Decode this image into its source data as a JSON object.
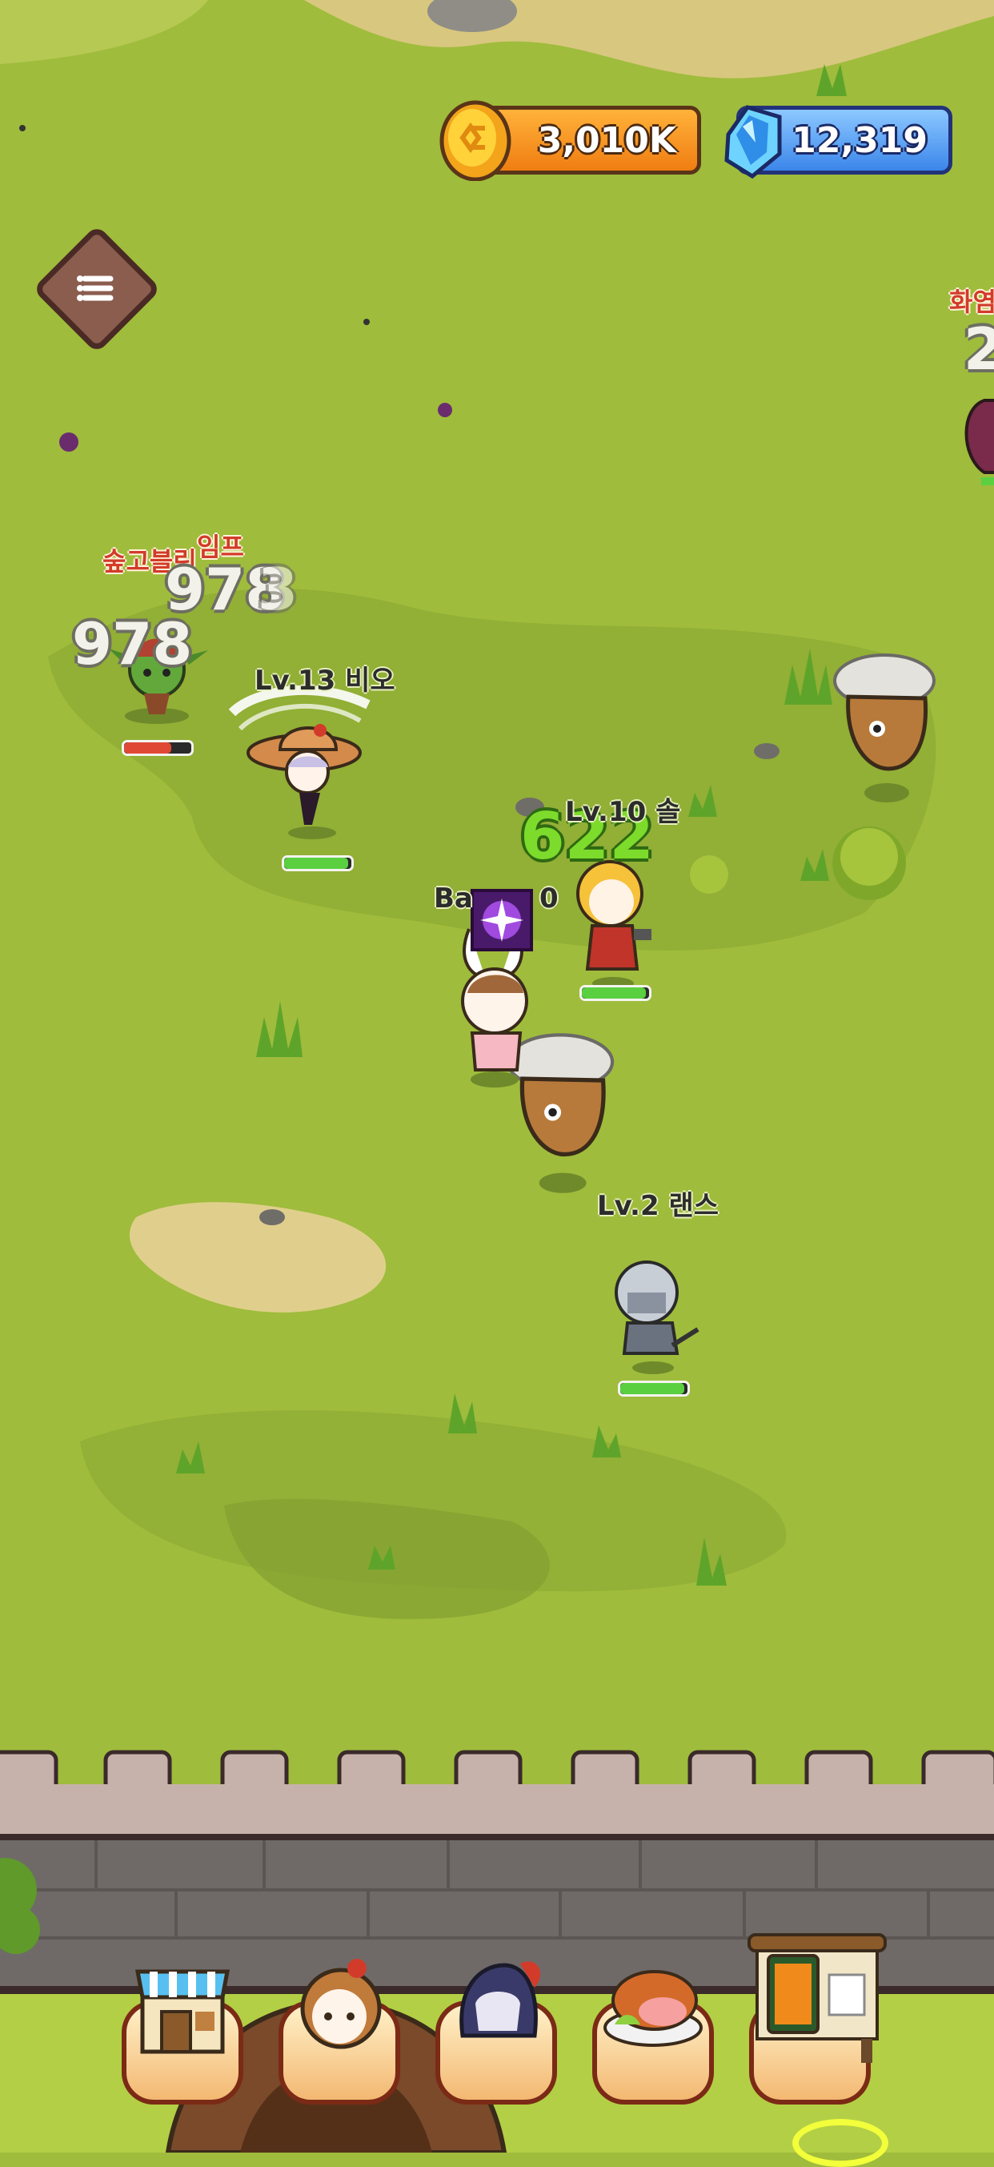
{
  "hud": {
    "gold": "3,010K",
    "gems": "12,319"
  },
  "heroes": [
    {
      "label": "Lv.13 비오"
    },
    {
      "label": "Lv.10 솔"
    },
    {
      "label": "Lv.2 랜스"
    },
    {
      "label": "Ba"
    },
    {
      "label": "0"
    }
  ],
  "enemies": [
    {
      "name": "숲고블린"
    },
    {
      "name": "임프"
    },
    {
      "name": "화염"
    }
  ],
  "damage_numbers": {
    "d1": "978",
    "d2": "978",
    "d3": "3",
    "heal": "622",
    "edge": "2"
  },
  "dock": {
    "items": [
      "shop-icon",
      "hero-icon",
      "knight-helmet-icon",
      "food-icon",
      "card-board-icon"
    ],
    "selected": 4
  },
  "colors": {
    "grass": "#9fbc3c",
    "wall": "#6f6a68",
    "gold": "#f07d12",
    "gem": "#3b86ea"
  }
}
